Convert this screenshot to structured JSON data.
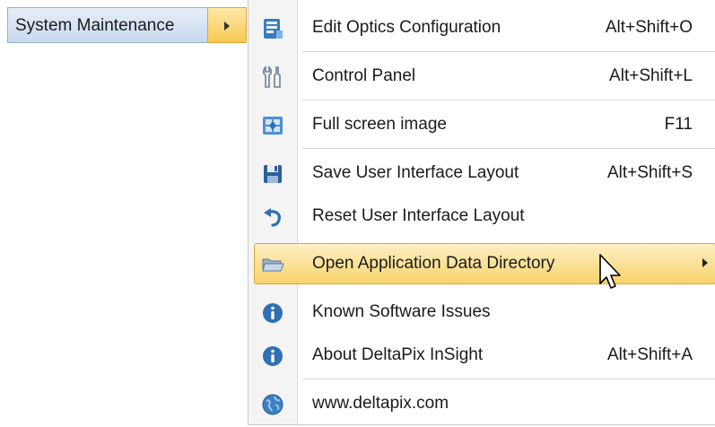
{
  "parent_menu": {
    "label": "System Maintenance"
  },
  "submenu": {
    "items": [
      {
        "icon": "edit-optics-icon",
        "label": "Edit Optics Configuration",
        "shortcut": "Alt+Shift+O"
      },
      {
        "icon": "control-panel-icon",
        "label": "Control Panel",
        "shortcut": "Alt+Shift+L"
      },
      {
        "icon": "fullscreen-icon",
        "label": "Full screen image",
        "shortcut": "F11"
      },
      {
        "icon": "save-icon",
        "label": "Save User Interface Layout",
        "shortcut": "Alt+Shift+S"
      },
      {
        "icon": "undo-icon",
        "label": "Reset User Interface Layout",
        "shortcut": ""
      },
      {
        "icon": "folder-icon",
        "label": "Open Application Data Directory",
        "shortcut": "",
        "highlighted": true,
        "has_submenu": true
      },
      {
        "icon": "info-icon",
        "label": "Known Software Issues",
        "shortcut": ""
      },
      {
        "icon": "info-icon",
        "label": "About DeltaPix InSight",
        "shortcut": "Alt+Shift+A"
      },
      {
        "icon": "globe-icon",
        "label": "www.deltapix.com",
        "shortcut": ""
      }
    ]
  },
  "colors": {
    "highlight_top": "#fdf0c4",
    "highlight_bottom": "#f8d36c",
    "highlight_border": "#d8a738",
    "parent_selection": "#c9d8ee",
    "icon_blue": "#2f6fb3"
  }
}
